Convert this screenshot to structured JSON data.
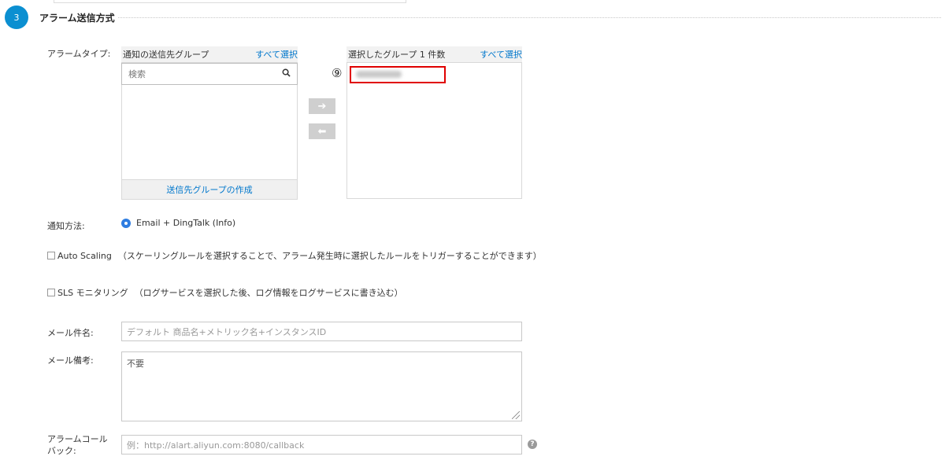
{
  "section": {
    "step_number": "3",
    "title": "アラーム送信方式"
  },
  "alarm_type": {
    "label": "アラームタイプ:",
    "left_panel": {
      "title": "通知の送信先グループ",
      "select_all": "すべて選択",
      "search_placeholder": "検索",
      "create_group": "送信先グループの作成"
    },
    "transfer": {
      "move_right": "➔",
      "move_left": "⬅"
    },
    "right_panel": {
      "title": "選択したグループ 1 件数",
      "select_all": "すべて選択",
      "annotation": "⑨",
      "selected_item": "testing-only"
    }
  },
  "notification": {
    "label": "通知方法:",
    "option": "Email + DingTalk (Info)",
    "selected": true
  },
  "auto_scaling": {
    "label": "Auto Scaling",
    "note": "（スケーリングルールを選択することで、アラーム発生時に選択したルールをトリガーすることができます）",
    "checked": false
  },
  "sls": {
    "label": "SLS モニタリング",
    "note": "（ログサービスを選択した後、ログ情報をログサービスに書き込む）",
    "checked": false
  },
  "mail_subject": {
    "label": "メール件名:",
    "placeholder": "デフォルト 商品名+メトリック名+インスタンスID"
  },
  "mail_note": {
    "label": "メール備考:",
    "value": "不要"
  },
  "callback": {
    "label_line1": "アラームコール",
    "label_line2": "バック:",
    "placeholder": "例：http://alart.aliyun.com:8080/callback",
    "help_icon": "?"
  },
  "colors": {
    "accent": "#0b8fd1",
    "link": "#0077cc",
    "highlight": "#e00000"
  }
}
